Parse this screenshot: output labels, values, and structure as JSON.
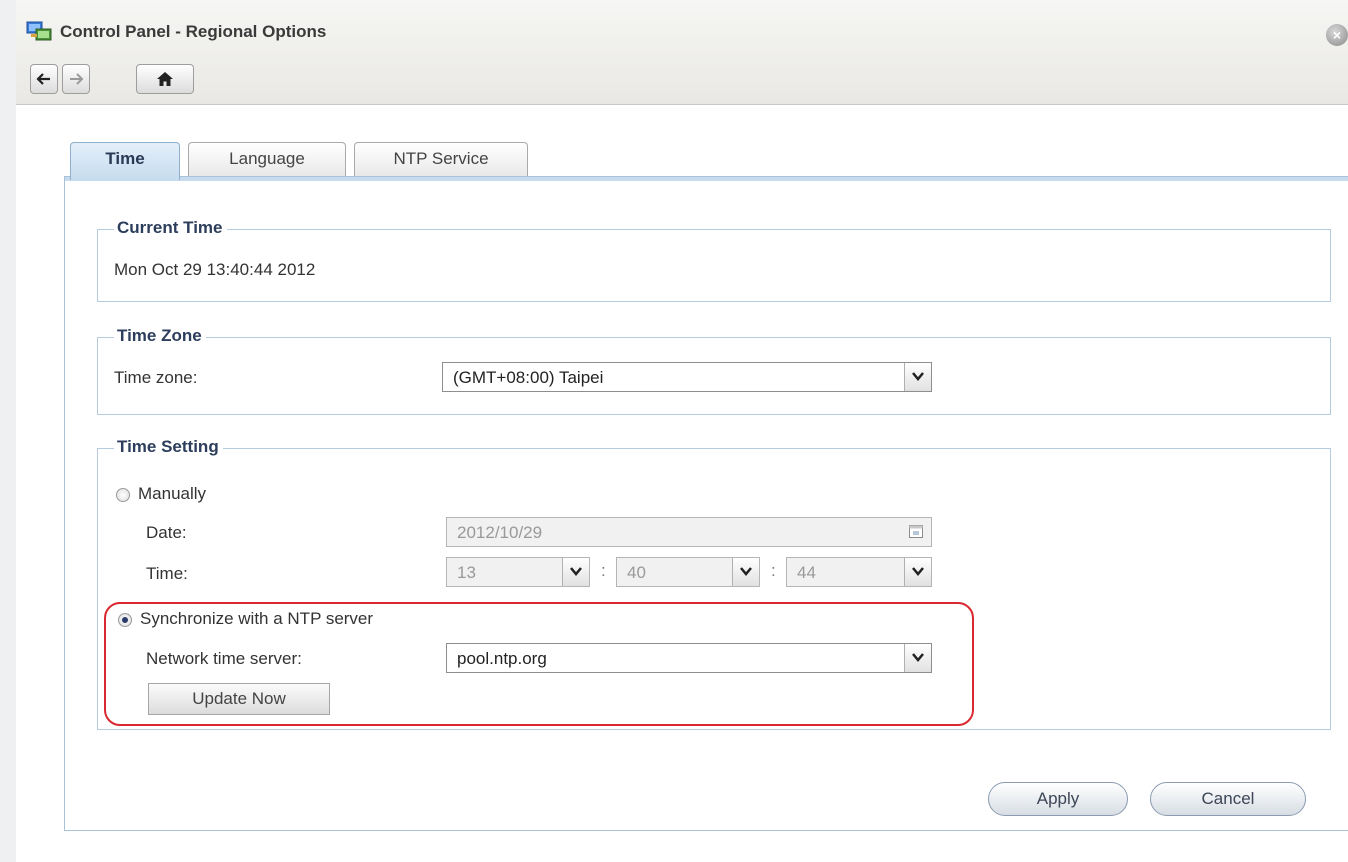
{
  "window": {
    "title": "Control Panel - Regional Options",
    "app_icon": "control-panel-icon",
    "close_icon": "close-icon"
  },
  "toolbar": {
    "back_icon": "arrow-left-icon",
    "forward_icon": "arrow-right-icon",
    "home_icon": "home-icon"
  },
  "tabs": [
    {
      "label": "Time",
      "active": true
    },
    {
      "label": "Language",
      "active": false
    },
    {
      "label": "NTP Service",
      "active": false
    }
  ],
  "current_time": {
    "legend": "Current Time",
    "value": "Mon Oct 29 13:40:44 2012"
  },
  "time_zone": {
    "legend": "Time Zone",
    "label": "Time zone:",
    "value": "(GMT+08:00) Taipei"
  },
  "time_setting": {
    "legend": "Time Setting",
    "manual": {
      "label": "Manually",
      "checked": false,
      "date_label": "Date:",
      "date_value": "2012/10/29",
      "time_label": "Time:",
      "hour": "13",
      "minute": "40",
      "second": "44"
    },
    "ntp": {
      "label": "Synchronize with a NTP server",
      "checked": true,
      "server_label": "Network time server:",
      "server_value": "pool.ntp.org",
      "update_button": "Update Now"
    }
  },
  "actions": {
    "apply": "Apply",
    "cancel": "Cancel"
  },
  "colors": {
    "highlight": "#d9282f",
    "active_tab": "#c6dcee",
    "legend_text": "#2d3e5c"
  }
}
